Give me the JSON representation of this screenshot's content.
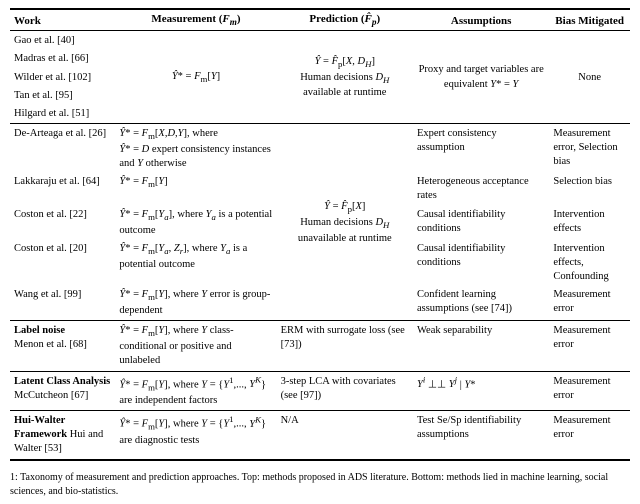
{
  "table": {
    "headers": {
      "work": "Work",
      "measurement": "Measurement (Fₘ)",
      "prediction": "Prediction (Fₚ)",
      "assumptions": "Assumptions",
      "bias": "Bias Mitigated"
    },
    "groups": [
      {
        "id": "group1",
        "rows": [
          {
            "work": "Gao et al. [40]",
            "measurement": "",
            "prediction": "",
            "assumptions": "",
            "bias": ""
          },
          {
            "work": "Madras et al. [66]",
            "measurement": "Ŷ* = Fₘ[Y]",
            "prediction": "Ŷ = F̂ₚ[X, Dₕ]\nHuman decisions Dₕ available at runtime",
            "assumptions": "Proxy and target variables are equivalent Y* = Y",
            "bias": "None"
          },
          {
            "work": "Wilder et al. [102]",
            "measurement": "",
            "prediction": "",
            "assumptions": "",
            "bias": ""
          },
          {
            "work": "Tan et al. [95]",
            "measurement": "",
            "prediction": "",
            "assumptions": "",
            "bias": ""
          },
          {
            "work": "Hilgard et al. [51]",
            "measurement": "",
            "prediction": "",
            "assumptions": "",
            "bias": ""
          }
        ]
      },
      {
        "id": "group2",
        "rows": [
          {
            "work": "De-Arteaga et al. [26]",
            "measurement": "Ŷ* = Fₘ[X,D,Y], where\nŶ* = D expert consistency instances and Y otherwise",
            "prediction": "",
            "assumptions": "Expert consistency assumption",
            "bias": "Measurement error, Selection bias"
          },
          {
            "work": "Lakkaraju et al. [64]",
            "measurement": "Ŷ* = Fₘ[Y]",
            "prediction": "Ŷ = F̂ₚ[X]\nHuman decisions Dₕ unavailable at runtime",
            "assumptions": "Heterogeneous acceptance rates",
            "bias": "Selection bias"
          },
          {
            "work": "Coston et al. [22]",
            "measurement": "Ŷ* = Fₘ[Yₐ], where Yₐ is a potential outcome",
            "prediction": "",
            "assumptions": "Causal identifiability conditions",
            "bias": "Intervention effects"
          },
          {
            "work": "Coston et al. [20]",
            "measurement": "Ŷ* = Fₘ[Yₐ, Z_r], where Yₐ is a potential outcome",
            "prediction": "",
            "assumptions": "Causal identifiability conditions",
            "bias": "Intervention effects, Confounding"
          },
          {
            "work": "Wang et al. [99]",
            "measurement": "Ŷ* = Fₘ[Y], where Y error is group-dependent",
            "prediction": "",
            "assumptions": "Confident learning assumptions (see [74])",
            "bias": "Measurement error"
          }
        ]
      },
      {
        "id": "group3",
        "label": "Label noise",
        "rows": [
          {
            "work": "Label noise\nMenon et al. [68]",
            "measurement": "Ŷ* = Fₘ[Y], where Y class-conditional or positive and unlabeled",
            "prediction": "ERM with surrogate loss (see [73])",
            "assumptions": "Weak separability",
            "bias": "Measurement error"
          }
        ]
      },
      {
        "id": "group4",
        "label": "Latent Class Analysis",
        "rows": [
          {
            "work": "Latent Class Analysis\nMcCutcheon [67]",
            "measurement": "Ŷ* = Fₘ[Y], where Y = {Y¹,..., Yᴷ} are independent factors",
            "prediction": "3-step LCA with covariates (see [97])",
            "assumptions": "Yⁱ ⊥⊥ Yʲ | Y*",
            "bias": "Measurement error"
          }
        ]
      },
      {
        "id": "group5",
        "label": "Hui-Walter Framework",
        "rows": [
          {
            "work": "Hui-Walter Framework Hui and Walter [53]",
            "measurement": "Ŷ* = Fₘ[Y], where Y = {Y¹,..., Yᴷ} are diagnostic tests",
            "prediction": "N/A",
            "assumptions": "Test Se/Sp identifiability assumptions",
            "bias": "Measurement error"
          }
        ]
      }
    ],
    "caption": "1: Taxonomy of measurement and prediction approaches. Top: methods proposed in ADS literature. Bottom: methods lied in machine learning, social sciences, and bio-statistics."
  }
}
